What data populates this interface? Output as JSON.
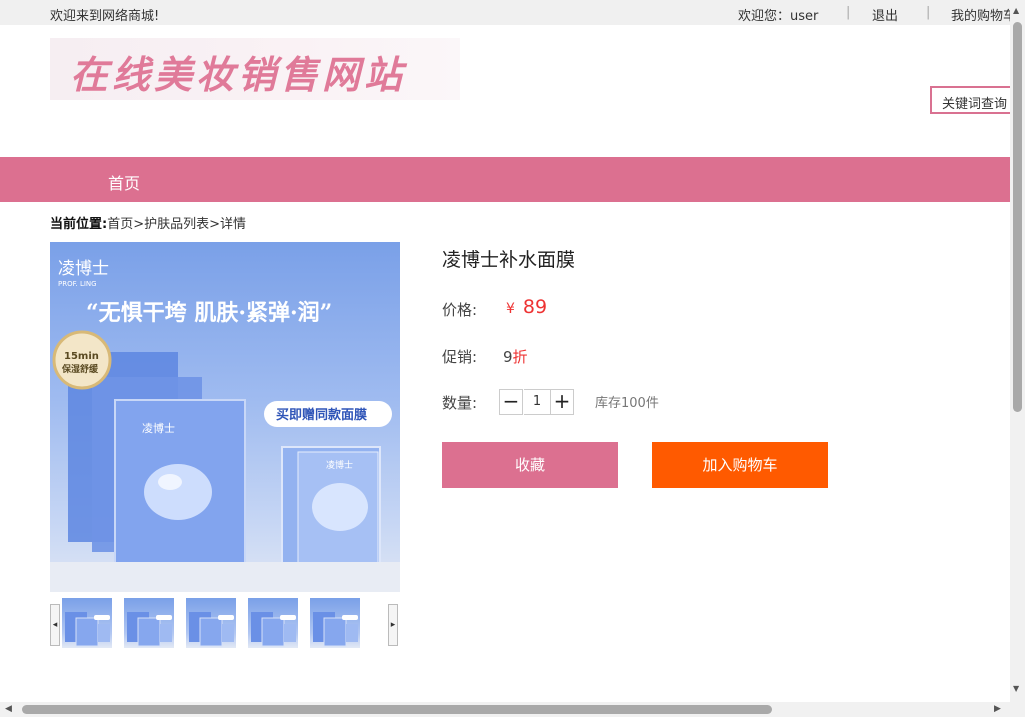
{
  "topbar": {
    "welcome": "欢迎来到网络商城!",
    "user_greeting": "欢迎您：user",
    "separator": "|",
    "logout": "退出",
    "my_cart": "我的购物车"
  },
  "logo": {
    "text": "在线美妆销售网站"
  },
  "search": {
    "placeholder": "关键词查询"
  },
  "nav": {
    "home": "首页"
  },
  "breadcrumb": {
    "lead": "当前位置:",
    "items": [
      "首页",
      "护肤品列表",
      "详情"
    ],
    "sep": ">"
  },
  "product": {
    "name": "凌博士补水面膜",
    "price_label": "价格:",
    "currency": "¥",
    "price": "89",
    "promo_label": "促销:",
    "promo_value": "9",
    "promo_unit": "折",
    "qty_label": "数量:",
    "qty_minus": "−",
    "qty_value": "1",
    "qty_plus": "+",
    "stock": "库存100件",
    "favorite_button": "收藏",
    "add_cart_button": "加入购物车"
  },
  "image": {
    "brand": "凌博士",
    "brand_en": "PROF. LING",
    "slogan": "“无惧干垮 肌肤·紧弹·润”",
    "badge_top": "15min",
    "badge_bottom": "保湿舒缓",
    "gift": "买即赠同款面膜"
  },
  "thumbs": {
    "count": 5,
    "left_arrow": "◂",
    "right_arrow": "▸"
  },
  "scroll": {
    "up": "▲",
    "down": "▼",
    "left": "◀",
    "right": "▶"
  }
}
